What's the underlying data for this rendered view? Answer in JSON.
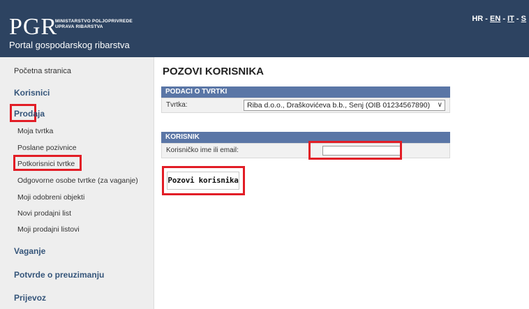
{
  "header": {
    "logo": "PGR",
    "ministry_line1": "MINISTARSTVO POLJOPRIVREDE",
    "ministry_line2": "UPRAVA RIBARSTVA",
    "portal_title": "Portal gospodarskog ribarstva",
    "languages": [
      "HR",
      "EN",
      "IT",
      "S"
    ]
  },
  "sidebar": {
    "home": "Početna stranica",
    "korisnici": "Korisnici",
    "prodaja": "Prodaja",
    "prodaja_items": [
      "Moja tvrtka",
      "Poslane pozivnice",
      "Potkorisnici tvrtke",
      "Odgovorne osobe tvrtke (za vaganje)",
      "Moji odobreni objekti",
      "Novi prodajni list",
      "Moji prodajni listovi"
    ],
    "vaganje": "Vaganje",
    "potvrde": "Potvrde o preuzimanju",
    "prijevoz": "Prijevoz"
  },
  "main": {
    "page_title": "POZOVI KORISNIKA",
    "company_section": {
      "heading": "PODACI O TVRTKI",
      "label": "Tvrtka:",
      "selected": "Riba d.o.o., Draškovićeva b.b., Senj (OIB 01234567890)"
    },
    "user_section": {
      "heading": "KORISNIK",
      "label": "Korisničko ime ili email:",
      "value": ""
    },
    "invite_button": "Pozovi korisnika"
  },
  "colors": {
    "header_bg": "#2d4361",
    "section_head_bg": "#5a76a6",
    "highlight": "#e21d26",
    "sidebar_section": "#35557a"
  }
}
